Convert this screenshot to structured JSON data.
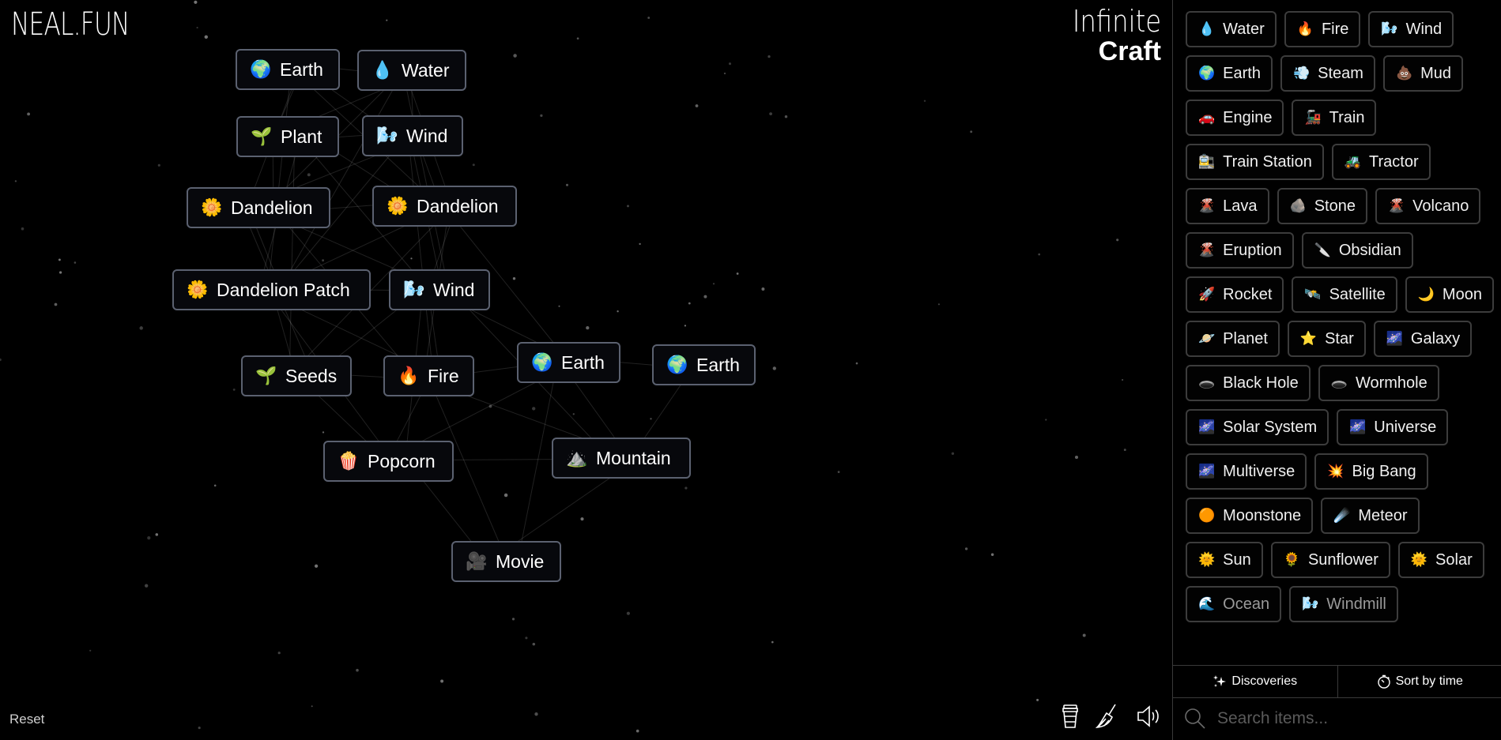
{
  "app": {
    "logo": "NEAL.FUN",
    "title_line1": "Infinite",
    "title_line2": "Craft",
    "background": "#000000",
    "node_border": "#5b6170",
    "item_border": "#3c3c3c"
  },
  "canvas": {
    "nodes": [
      {
        "id": "n1",
        "icon": "earth-globe-icon",
        "emoji": "🌍",
        "label": "Earth"
      },
      {
        "id": "n2",
        "icon": "water-drop-icon",
        "emoji": "💧",
        "label": "Water"
      },
      {
        "id": "n3",
        "icon": "seedling-icon",
        "emoji": "🌱",
        "label": "Plant"
      },
      {
        "id": "n4",
        "icon": "wind-face-icon",
        "emoji": "🌬️",
        "label": "Wind"
      },
      {
        "id": "n5",
        "icon": "flower-icon",
        "emoji": "🌼",
        "label": "Dandelion"
      },
      {
        "id": "n6",
        "icon": "flower-icon",
        "emoji": "🌼",
        "label": "Dandelion"
      },
      {
        "id": "n7",
        "icon": "flower-icon",
        "emoji": "🌼",
        "label": "Dandelion Patch"
      },
      {
        "id": "n8",
        "icon": "wind-face-icon",
        "emoji": "🌬️",
        "label": "Wind"
      },
      {
        "id": "n9",
        "icon": "seedling-icon",
        "emoji": "🌱",
        "label": "Seeds"
      },
      {
        "id": "n10",
        "icon": "fire-icon",
        "emoji": "🔥",
        "label": "Fire"
      },
      {
        "id": "n11",
        "icon": "earth-globe-icon",
        "emoji": "🌍",
        "label": "Earth"
      },
      {
        "id": "n12",
        "icon": "earth-globe-icon",
        "emoji": "🌍",
        "label": "Earth"
      },
      {
        "id": "n13",
        "icon": "popcorn-icon",
        "emoji": "🍿",
        "label": "Popcorn"
      },
      {
        "id": "n14",
        "icon": "mountain-icon",
        "emoji": "⛰️",
        "label": "Mountain"
      },
      {
        "id": "n15",
        "icon": "movie-camera-icon",
        "emoji": "🎥",
        "label": "Movie"
      }
    ],
    "reset_label": "Reset",
    "tools": [
      {
        "name": "coffee-cup-icon"
      },
      {
        "name": "broom-icon"
      },
      {
        "name": "speaker-icon"
      }
    ]
  },
  "sidebar": {
    "items": [
      {
        "emoji": "💧",
        "label": "Water",
        "icon": "water-drop-icon"
      },
      {
        "emoji": "🔥",
        "label": "Fire",
        "icon": "fire-icon"
      },
      {
        "emoji": "🌬️",
        "label": "Wind",
        "icon": "wind-face-icon"
      },
      {
        "emoji": "🌍",
        "label": "Earth",
        "icon": "earth-globe-icon"
      },
      {
        "emoji": "💨",
        "label": "Steam",
        "icon": "steam-cloud-icon"
      },
      {
        "emoji": "💩",
        "label": "Mud",
        "icon": "mud-pile-icon"
      },
      {
        "emoji": "🚗",
        "label": "Engine",
        "icon": "car-icon"
      },
      {
        "emoji": "🚂",
        "label": "Train",
        "icon": "locomotive-icon"
      },
      {
        "emoji": "🚉",
        "label": "Train Station",
        "icon": "station-icon"
      },
      {
        "emoji": "🚜",
        "label": "Tractor",
        "icon": "tractor-icon"
      },
      {
        "emoji": "🌋",
        "label": "Lava",
        "icon": "volcano-icon"
      },
      {
        "emoji": "🪨",
        "label": "Stone",
        "icon": "rock-icon"
      },
      {
        "emoji": "🌋",
        "label": "Volcano",
        "icon": "volcano-icon"
      },
      {
        "emoji": "🌋",
        "label": "Eruption",
        "icon": "volcano-icon"
      },
      {
        "emoji": "🔪",
        "label": "Obsidian",
        "icon": "knife-icon"
      },
      {
        "emoji": "🚀",
        "label": "Rocket",
        "icon": "rocket-icon"
      },
      {
        "emoji": "🛰️",
        "label": "Satellite",
        "icon": "satellite-icon"
      },
      {
        "emoji": "🌙",
        "label": "Moon",
        "icon": "crescent-moon-icon"
      },
      {
        "emoji": "🪐",
        "label": "Planet",
        "icon": "ringed-planet-icon"
      },
      {
        "emoji": "⭐",
        "label": "Star",
        "icon": "star-icon"
      },
      {
        "emoji": "🌌",
        "label": "Galaxy",
        "icon": "milky-way-icon"
      },
      {
        "emoji": "🕳️",
        "label": "Black Hole",
        "icon": "hole-icon"
      },
      {
        "emoji": "🕳️",
        "label": "Wormhole",
        "icon": "hole-icon"
      },
      {
        "emoji": "🌌",
        "label": "Solar System",
        "icon": "milky-way-icon"
      },
      {
        "emoji": "🌌",
        "label": "Universe",
        "icon": "milky-way-icon"
      },
      {
        "emoji": "🌌",
        "label": "Multiverse",
        "icon": "milky-way-icon"
      },
      {
        "emoji": "💥",
        "label": "Big Bang",
        "icon": "collision-icon"
      },
      {
        "emoji": "🟠",
        "label": "Moonstone",
        "icon": "orange-circle-icon"
      },
      {
        "emoji": "☄️",
        "label": "Meteor",
        "icon": "comet-icon"
      },
      {
        "emoji": "🌞",
        "label": "Sun",
        "icon": "sun-icon"
      },
      {
        "emoji": "🌻",
        "label": "Sunflower",
        "icon": "sunflower-icon"
      },
      {
        "emoji": "🌞",
        "label": "Solar",
        "icon": "sun-icon"
      },
      {
        "emoji": "🌊",
        "label": "Ocean",
        "icon": "wave-icon",
        "faded": true
      },
      {
        "emoji": "🌬️",
        "label": "Windmill",
        "icon": "wind-face-icon",
        "faded": true
      }
    ],
    "tabs": [
      {
        "label": "Discoveries",
        "icon": "sparkles-icon"
      },
      {
        "label": "Sort by time",
        "icon": "stopwatch-icon"
      }
    ],
    "search": {
      "placeholder": "Search items...",
      "value": ""
    }
  }
}
